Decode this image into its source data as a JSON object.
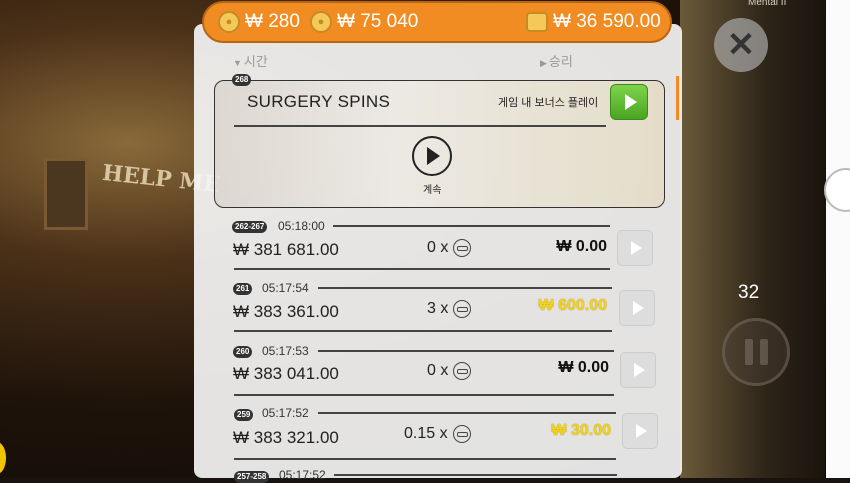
{
  "header": {
    "coins": "₩ 280",
    "coin_value": "₩ 75 040",
    "balance": "₩ 36 590.00"
  },
  "device": {
    "label": "Mental II"
  },
  "side": {
    "close_glyph": "✕",
    "spin_counter": "32"
  },
  "history": {
    "col_time": "시간",
    "col_win": "승리",
    "feature": {
      "id": "268",
      "title": "SURGERY SPINS",
      "bonus_label": "게임 내 보너스 플레이",
      "continue_label": "계속"
    },
    "rows": [
      {
        "id": "262-267",
        "time": "05:18:00",
        "balance": "₩ 381 681.00",
        "multiplier": "0 x",
        "win": "₩ 0.00"
      },
      {
        "id": "261",
        "time": "05:17:54",
        "balance": "₩ 383 361.00",
        "multiplier": "3 x",
        "win": "₩ 600.00"
      },
      {
        "id": "260",
        "time": "05:17:53",
        "balance": "₩ 383 041.00",
        "multiplier": "0 x",
        "win": "₩ 0.00"
      },
      {
        "id": "259",
        "time": "05:17:52",
        "balance": "₩ 383 321.00",
        "multiplier": "0.15 x",
        "win": "₩ 30.00"
      },
      {
        "id": "257-258",
        "time": "05:17:52"
      }
    ]
  },
  "background": {
    "graffiti": "HELP ME"
  }
}
